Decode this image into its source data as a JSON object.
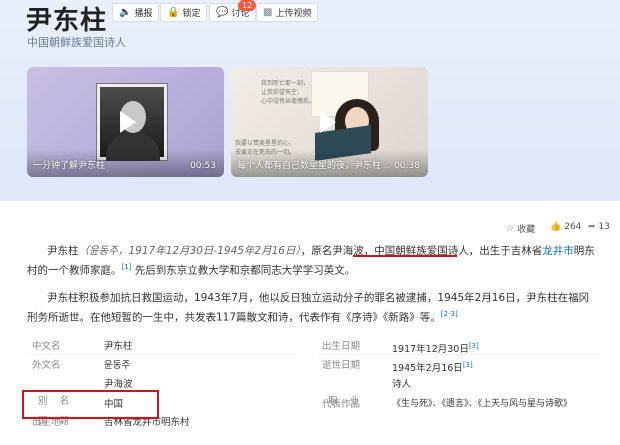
{
  "header": {
    "title": "尹东柱",
    "subtitle": "中国朝鲜族爱国诗人",
    "toolbar": {
      "play_label": "播报",
      "lock_label": "锁定",
      "discuss_label": "讨论",
      "discuss_count": "12",
      "upload_label": "上传视频"
    }
  },
  "videos": [
    {
      "caption": "一分钟了解尹东柱",
      "duration": "00:53"
    },
    {
      "caption": "每个人都有自己数星星的夜，尹东柱...",
      "duration": "00:38",
      "poem_top": "我到死亡那一刻，\n让我仰望天空，\n心中没有丝毫愧疚。",
      "poem_bottom": "我要以赞美星星的心，\n去爱正在死去的一切。"
    }
  ],
  "actions": {
    "collect_label": "收藏",
    "like_count": "264",
    "share_count": "13"
  },
  "intro": {
    "p1_name": "尹东柱",
    "p1_korean": "（윤동주，1917年12月30日-1945年2月16日）",
    "p1_a": "，原名尹海波，",
    "p1_highlight": "中国朝鲜族爱国诗人",
    "p1_b": "，出生于吉林省",
    "p1_link": "龙井市",
    "p1_c": "明东村的一个教师家庭。",
    "p1_ref": "[1]",
    "p1_d": " 先后到东京立教大学和京都同志大学学习英文。",
    "p2": "尹东柱积极参加抗日救国运动，1943年7月，他以反日独立运动分子的罪名被逮捕，1945年2月16日，尹东柱在福冈刑务所逝世。在他短暂的一生中，共发表117篇散文和诗，代表作有《序诗》《新路》等。",
    "p2_ref": "[2-3]"
  },
  "basic_info": {
    "left": [
      {
        "label": "中文名",
        "value": "尹东柱"
      },
      {
        "label": "外文名",
        "value": "윤동주"
      },
      {
        "label": "别    名",
        "value": "尹海波"
      },
      {
        "label": "国    籍",
        "value": "中国"
      },
      {
        "label": "出生地",
        "value": "吉林省龙井市明东村"
      }
    ],
    "right": [
      {
        "label": "出生日期",
        "value": "1917年12月30日",
        "ref": "[3]"
      },
      {
        "label": "逝世日期",
        "value": "1945年2月16日",
        "ref": "[3]"
      },
      {
        "label": "职    业",
        "value": "诗人"
      },
      {
        "label": "代表作品",
        "value": "《生与死》、《遗言》、《上天与风与星与诗歌》"
      }
    ]
  }
}
